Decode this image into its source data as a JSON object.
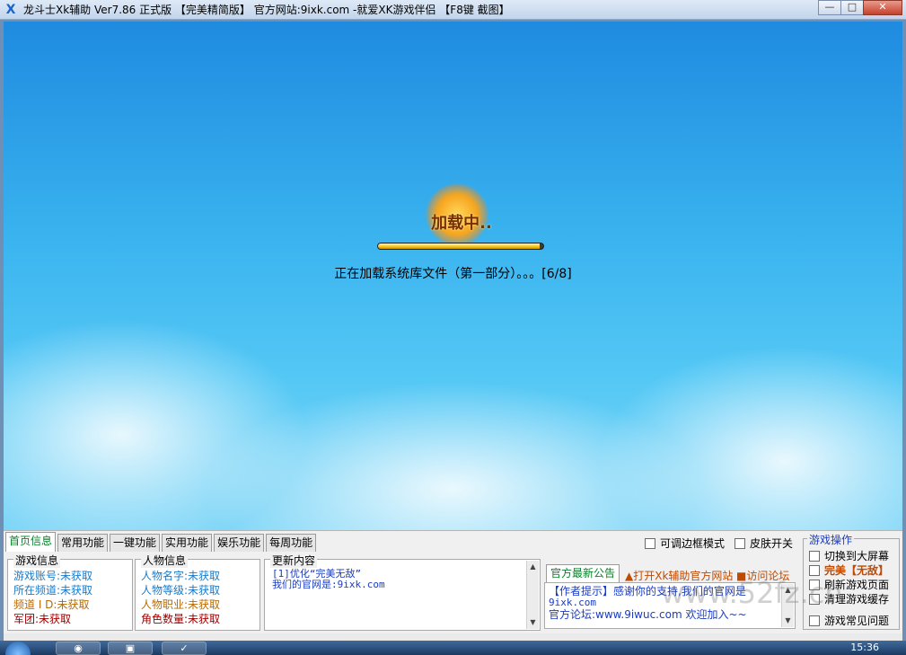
{
  "window": {
    "title": "龙斗士Xk辅助 Ver7.86 正式版 【完美精简版】    官方网站:9ixk.com   -就爱XK游戏伴侣  【F8键 截图】",
    "min": "—",
    "max": "□",
    "close": "✕"
  },
  "loader": {
    "badge": "加载中..",
    "progress": 0.98,
    "status": "正在加载系统库文件（第一部分）。。。[6/8]"
  },
  "tabs": [
    "首页信息",
    "常用功能",
    "一键功能",
    "实用功能",
    "娱乐功能",
    "每周功能"
  ],
  "options": {
    "resizable_border": "可调边框模式",
    "skin_toggle": "皮肤开关"
  },
  "game_info": {
    "title": "游戏信息",
    "account": "游戏账号:未获取",
    "channel": "所在频道:未获取",
    "channel_id": "频道 I D:未获取",
    "legion": "军团:未获取"
  },
  "char_info": {
    "title": "人物信息",
    "name": "人物名字:未获取",
    "level": "人物等级:未获取",
    "job": "人物职业:未获取",
    "count": "角色数量:未获取"
  },
  "update": {
    "title": "更新内容",
    "line1": "[1]优化“完美无敌”",
    "line2": "我们的官网是:9ixk.com"
  },
  "notice": {
    "tab": "官方最新公告",
    "open_site": "▲打开Xk辅助官方网站",
    "forum": "■访问论坛",
    "line1": "【作者提示】感谢你的支持,我们的官网是",
    "line2": "9ixk.com",
    "line3": "官方论坛:www.9iwuc.com 欢迎加入~~"
  },
  "ops": {
    "title": "游戏操作",
    "fullscreen": "切换到大屏幕",
    "invincible": "完美【无敌】",
    "refresh": "刷新游戏页面",
    "clear_cache": "清理游戏缓存",
    "faq": "游戏常见问题"
  },
  "taskbar": {
    "clock": "15:36"
  },
  "watermark": "www.52fz.cn",
  "colors": {
    "accent_green": "#0a7f2a",
    "link_blue": "#1b3cbf",
    "warn_orange": "#c04a00",
    "sky_top": "#1f8be0",
    "sky_bottom": "#7fd6f7"
  }
}
